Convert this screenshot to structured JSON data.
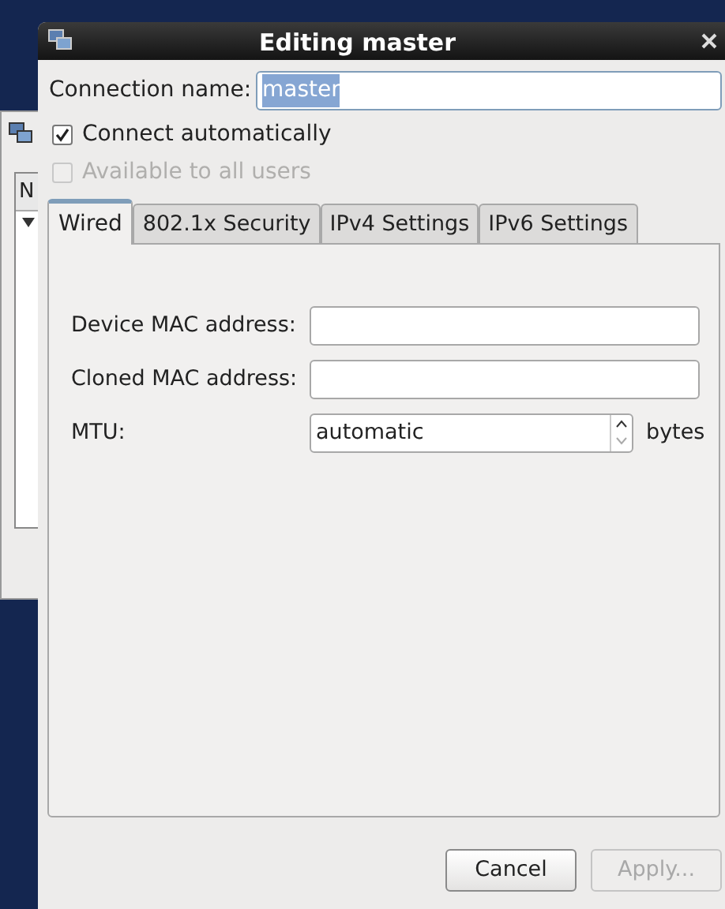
{
  "background_window": {
    "column_1": "N"
  },
  "window": {
    "title": "Editing master"
  },
  "connection_name": {
    "label": "Connection name:",
    "value": "master",
    "selected_text": true
  },
  "options": [
    {
      "label": "Connect automatically",
      "checked": true,
      "disabled": false
    },
    {
      "label": "Available to all users",
      "checked": false,
      "disabled": true
    }
  ],
  "tabs": [
    {
      "label": "Wired",
      "selected": true
    },
    {
      "label": "802.1x Security",
      "selected": false
    },
    {
      "label": "IPv4 Settings",
      "selected": false
    },
    {
      "label": "IPv6 Settings",
      "selected": false
    }
  ],
  "fields": [
    {
      "kind": "text",
      "label": "Device MAC address:"
    },
    {
      "kind": "text",
      "label": "Cloned MAC address:"
    },
    {
      "kind": "spin",
      "label": "MTU:",
      "value": "automatic",
      "unit": "bytes"
    }
  ],
  "buttons": [
    {
      "label": "Cancel",
      "disabled": false
    },
    {
      "label": "Apply...",
      "disabled": true
    }
  ]
}
